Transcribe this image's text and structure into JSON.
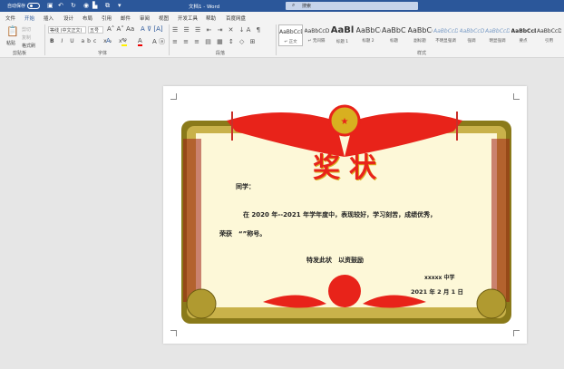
{
  "titlebar": {
    "autosave": "自动保存",
    "toggle": "关",
    "title": "文档1 - Word",
    "search_placeholder": "搜索"
  },
  "tabs": [
    "文件",
    "开始",
    "插入",
    "设计",
    "布局",
    "引用",
    "邮件",
    "审阅",
    "视图",
    "开发工具",
    "帮助",
    "百度网盘"
  ],
  "ribbon": {
    "clipboard": {
      "paste": "粘贴",
      "cut": "剪切",
      "copy": "复制",
      "format_painter": "格式刷",
      "group": "剪贴板"
    },
    "font": {
      "name": "等线 (中文正文)",
      "size": "五号",
      "group": "字体"
    },
    "paragraph": {
      "group": "段落"
    },
    "styles": {
      "group": "样式",
      "items": [
        {
          "preview": "AaBbCcDı",
          "name": "↵ 正文"
        },
        {
          "preview": "AaBbCcDı",
          "name": "↵ 无间隔"
        },
        {
          "preview": "AaBl",
          "name": "标题 1"
        },
        {
          "preview": "AaBbC(",
          "name": "标题 2"
        },
        {
          "preview": "AaBbC(",
          "name": "标题"
        },
        {
          "preview": "AaBbC(",
          "name": "副标题"
        },
        {
          "preview": "AaBbCcD.",
          "name": "不明显强调"
        },
        {
          "preview": "AaBbCcD.",
          "name": "强调"
        },
        {
          "preview": "AaBbCcD",
          "name": "明显强调"
        },
        {
          "preview": "AaBbCcD",
          "name": "要点"
        },
        {
          "preview": "AaBbCcDı",
          "name": "引用"
        }
      ]
    }
  },
  "certificate": {
    "title": "奖状",
    "salutation": "同学：",
    "body1": "在 2020 年--2021 年学年度中，表现较好，学习刻苦，成绩优秀，",
    "body2": "荣获　“”称号。",
    "closing": "特发此状　以资鼓励",
    "school": "xxxxx 中学",
    "date": "2021 年 2 月 1 日"
  },
  "colors": {
    "brand": "#2b579a",
    "frame": "#8a7a1a",
    "red": "#e8231a",
    "cream": "#fdf8d8"
  }
}
